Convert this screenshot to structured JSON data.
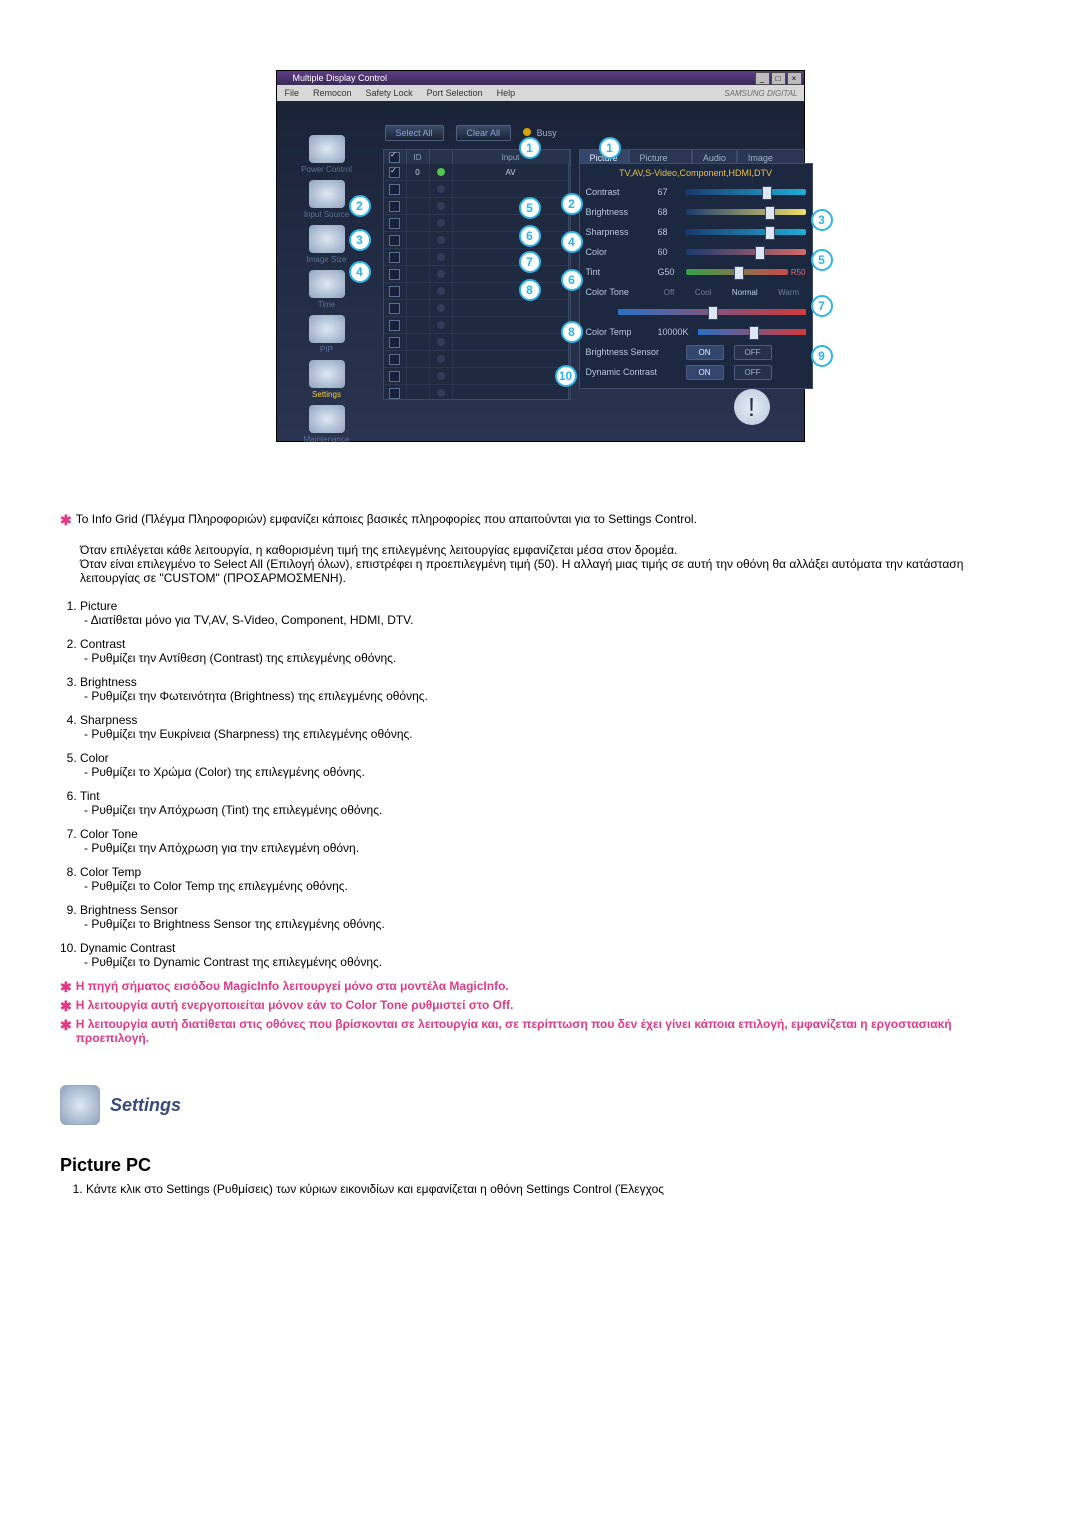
{
  "window": {
    "title": "Multiple Display Control",
    "brand": "SAMSUNG DIGITAL"
  },
  "menu": [
    "File",
    "Remocon",
    "Safety Lock",
    "Port Selection",
    "Help"
  ],
  "side": [
    {
      "label": "Power Control",
      "hot": false
    },
    {
      "label": "Input Source",
      "hot": false
    },
    {
      "label": "Image Size",
      "hot": false
    },
    {
      "label": "Time",
      "hot": false
    },
    {
      "label": "PIP",
      "hot": false
    },
    {
      "label": "Settings",
      "hot": true
    },
    {
      "label": "Maintenance",
      "hot": false
    }
  ],
  "buttons": {
    "select_all": "Select All",
    "clear_all": "Clear All",
    "busy": "Busy"
  },
  "grid": {
    "headers": [
      "",
      "ID",
      "",
      "Input"
    ],
    "rows": [
      {
        "chk": true,
        "id": "0",
        "led": "g",
        "input": "AV"
      },
      {
        "chk": false,
        "id": "",
        "led": "",
        "input": ""
      },
      {
        "chk": false,
        "id": "",
        "led": "",
        "input": ""
      },
      {
        "chk": false,
        "id": "",
        "led": "",
        "input": ""
      },
      {
        "chk": false,
        "id": "",
        "led": "",
        "input": ""
      },
      {
        "chk": false,
        "id": "",
        "led": "",
        "input": ""
      },
      {
        "chk": false,
        "id": "",
        "led": "",
        "input": ""
      },
      {
        "chk": false,
        "id": "",
        "led": "",
        "input": ""
      },
      {
        "chk": false,
        "id": "",
        "led": "",
        "input": ""
      },
      {
        "chk": false,
        "id": "",
        "led": "",
        "input": ""
      },
      {
        "chk": false,
        "id": "",
        "led": "",
        "input": ""
      },
      {
        "chk": false,
        "id": "",
        "led": "",
        "input": ""
      },
      {
        "chk": false,
        "id": "",
        "led": "",
        "input": ""
      },
      {
        "chk": false,
        "id": "",
        "led": "",
        "input": ""
      }
    ]
  },
  "tabs": [
    "Picture",
    "Picture PC",
    "Audio",
    "Image Lock"
  ],
  "panel": {
    "header": "TV,AV,S-Video,Component,HDMI,DTV",
    "contrast": {
      "name": "Contrast",
      "val": "67"
    },
    "brightness": {
      "name": "Brightness",
      "val": "68"
    },
    "sharpness": {
      "name": "Sharpness",
      "val": "68"
    },
    "color": {
      "name": "Color",
      "val": "60"
    },
    "tint": {
      "name": "Tint",
      "val": "G50",
      "r": "R50"
    },
    "color_tone": {
      "name": "Color Tone",
      "opts": [
        "Off",
        "Cool",
        "Normal",
        "Warm"
      ]
    },
    "color_temp": {
      "name": "Color Temp",
      "val": "10000K"
    },
    "bsensor": {
      "name": "Brightness Sensor",
      "on": "ON",
      "off": "OFF"
    },
    "dcontrast": {
      "name": "Dynamic Contrast",
      "on": "ON",
      "off": "OFF"
    }
  },
  "callouts_side": {
    "input_source": "2",
    "image_size": "3",
    "time": "4"
  },
  "callouts_grid": {
    "top": "1",
    "r1": "5",
    "r2": "6",
    "r3": "7",
    "r4": "8"
  },
  "callouts_panel": {
    "tabs": "1",
    "contrast": "2",
    "brightness": "3",
    "sharpness": "4",
    "color": "5",
    "tint": "6",
    "color_tone": "7",
    "color_temp": "8",
    "bsensor": "9",
    "dcontrast": "10"
  },
  "doc": {
    "info_grid": "Το Info Grid (Πλέγμα Πληροφοριών) εμφανίζει κάποιες βασικές πληροφορίες που απαιτούνται για το Settings Control.",
    "para2_a": "Όταν επιλέγεται κάθε λειτουργία, η καθορισμένη τιμή της επιλεγμένης λειτουργίας εμφανίζεται μέσα στον δρομέα.",
    "para2_b": "Όταν είναι επιλεγμένο το Select All (Επιλογή όλων), επιστρέφει η προεπιλεγμένη τιμή (50). Η αλλαγή μιας τιμής σε αυτή την οθόνη θα αλλάξει αυτόματα την κατάσταση λειτουργίας σε \"CUSTOM\" (ΠΡΟΣΑΡΜΟΣΜΕΝΗ).",
    "items": [
      {
        "t": "Picture",
        "d": "- Διατίθεται μόνο για TV,AV, S-Video, Component, HDMI, DTV."
      },
      {
        "t": "Contrast",
        "d": "- Ρυθμίζει την Αντίθεση (Contrast) της επιλεγμένης οθόνης."
      },
      {
        "t": "Brightness",
        "d": "- Ρυθμίζει την Φωτεινότητα (Brightness) της επιλεγμένης οθόνης."
      },
      {
        "t": "Sharpness",
        "d": "- Ρυθμίζει την Ευκρίνεια (Sharpness) της επιλεγμένης οθόνης."
      },
      {
        "t": "Color",
        "d": "- Ρυθμίζει το Χρώμα (Color) της επιλεγμένης οθόνης."
      },
      {
        "t": "Tint",
        "d": "- Ρυθμίζει την Απόχρωση (Tint) της επιλεγμένης οθόνης."
      },
      {
        "t": "Color Tone",
        "d": "- Ρυθμίζει την Απόχρωση για την επιλεγμένη οθόνη."
      },
      {
        "t": "Color Temp",
        "d": "- Ρυθμίζει το Color Temp της επιλεγμένης οθόνης."
      },
      {
        "t": "Brightness Sensor",
        "d": "- Ρυθμίζει το Brightness Sensor της επιλεγμένης οθόνης."
      },
      {
        "t": "Dynamic Contrast",
        "d": "- Ρυθμίζει το Dynamic Contrast της επιλεγμένης οθόνης."
      }
    ],
    "red1": "Η πηγή σήματος εισόδου MagicInfo λειτουργεί μόνο στα μοντέλα MagicInfo.",
    "red2": "Η λειτουργία αυτή ενεργοποιείται μόνον εάν το Color Tone ρυθμιστεί στο Off.",
    "red3": "Η λειτουργία αυτή διατίθεται στις οθόνες που βρίσκονται σε λειτουργία και, σε περίπτωση που δεν έχει γίνει κάποια επιλογή, εμφανίζεται η εργοστασιακή προεπιλογή.",
    "sec_title": "Settings",
    "h2": "Picture PC",
    "step1": "Κάντε κλικ στο Settings (Ρυθμίσεις) των κύριων εικονιδίων και εμφανίζεται η οθόνη Settings Control (Έλεγχος"
  }
}
